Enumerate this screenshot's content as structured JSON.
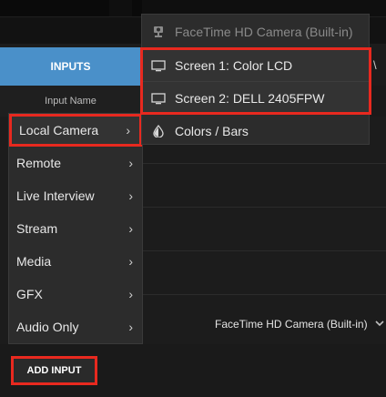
{
  "background": {
    "inputs_tab": "INPUTS",
    "column_header": "Input Name",
    "corner_hint": "\\",
    "camera_select": "FaceTime HD Camera (Built-in)",
    "add_input": "ADD INPUT"
  },
  "menu": {
    "items": [
      {
        "label": "Local Camera",
        "arrow": "›"
      },
      {
        "label": "Remote",
        "arrow": "›"
      },
      {
        "label": "Live Interview",
        "arrow": "›"
      },
      {
        "label": "Stream",
        "arrow": "›"
      },
      {
        "label": "Media",
        "arrow": "›"
      },
      {
        "label": "GFX",
        "arrow": "›"
      },
      {
        "label": "Audio Only",
        "arrow": "›"
      }
    ]
  },
  "submenu": {
    "items": [
      {
        "label": "FaceTime HD Camera (Built-in)",
        "icon": "webcam-icon"
      },
      {
        "label": "Screen 1: Color LCD",
        "icon": "monitor-icon"
      },
      {
        "label": "Screen 2: DELL 2405FPW",
        "icon": "monitor-icon"
      },
      {
        "label": "Colors / Bars",
        "icon": "color-drop-icon"
      }
    ]
  },
  "colors": {
    "accent_blue": "#4a90c9",
    "highlight_red": "#e8291f"
  }
}
